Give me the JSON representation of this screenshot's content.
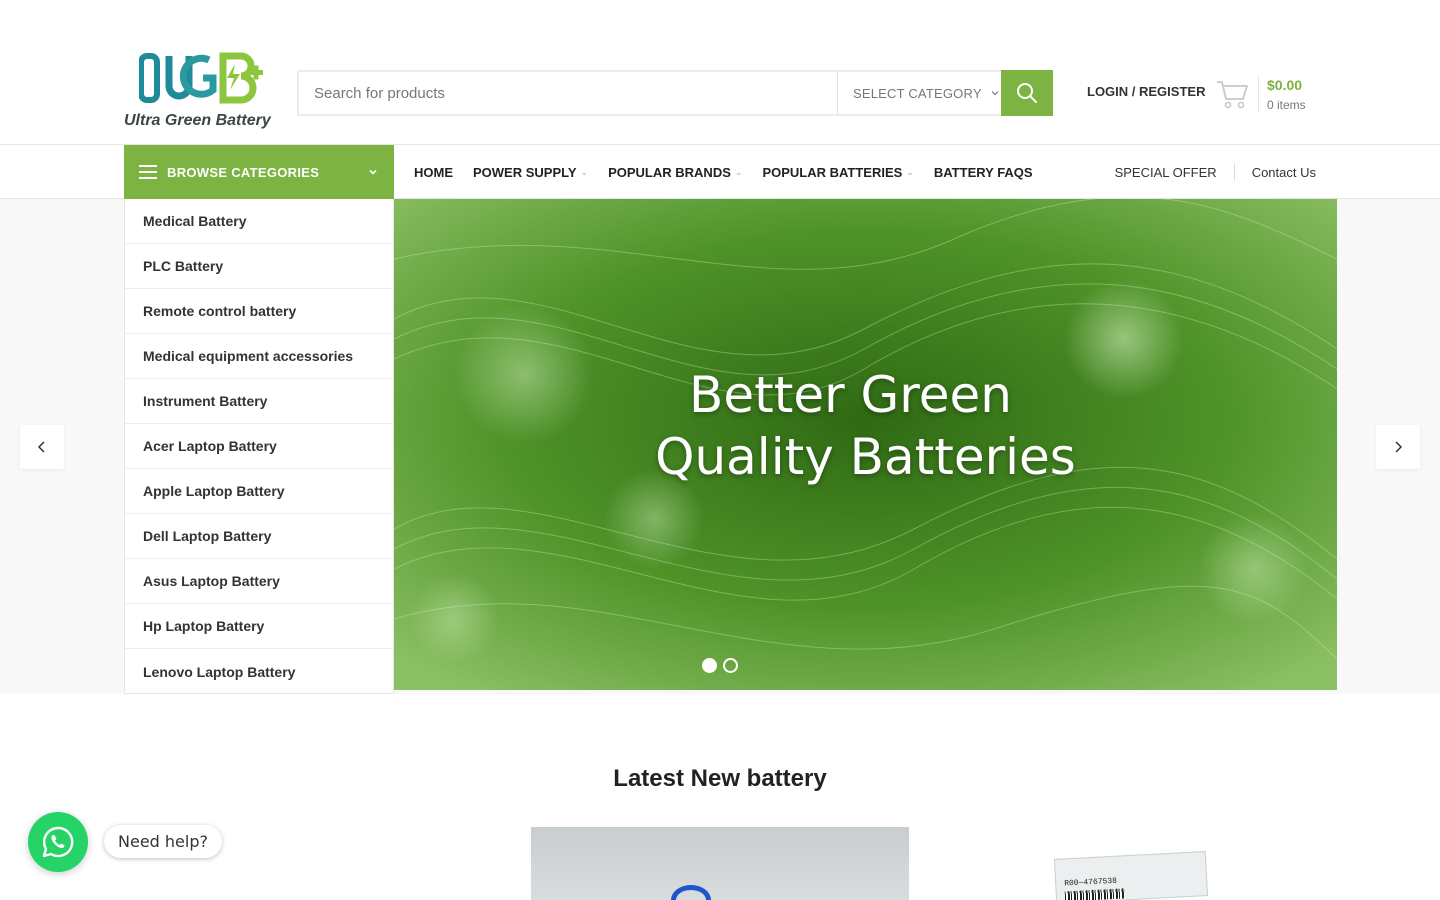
{
  "brand": {
    "logo_letters": "UGB",
    "name": "Ultra Green Battery",
    "colors": {
      "primary_green": "#7cb342",
      "logo_teal": "#1f8a9a",
      "logo_lime": "#8cc63f"
    }
  },
  "header": {
    "search_placeholder": "Search for products",
    "category_select": "SELECT CATEGORY",
    "search_icon": "search-icon",
    "login_label": "LOGIN / REGISTER",
    "cart": {
      "total": "$0.00",
      "items": "0 items",
      "icon": "cart-icon"
    }
  },
  "nav": {
    "browse_label": "BROWSE CATEGORIES",
    "menu": [
      {
        "label": "HOME",
        "dropdown": false
      },
      {
        "label": "POWER SUPPLY",
        "dropdown": true
      },
      {
        "label": "POPULAR BRANDS",
        "dropdown": true
      },
      {
        "label": "POPULAR BATTERIES",
        "dropdown": true
      },
      {
        "label": "BATTERY FAQS",
        "dropdown": false
      }
    ],
    "right_links": [
      "SPECIAL OFFER",
      "Contact Us"
    ]
  },
  "categories": [
    "Medical Battery",
    "PLC Battery",
    "Remote control battery",
    "Medical equipment accessories",
    "Instrument Battery",
    "Acer Laptop Battery",
    "Apple Laptop Battery",
    "Dell Laptop Battery",
    "Asus Laptop Battery",
    "Hp Laptop Battery",
    "Lenovo Laptop Battery"
  ],
  "slider": {
    "title_line1": "Better Green",
    "title_line2": "Quality Batteries",
    "slide_count": 2,
    "active_slide": 1
  },
  "latest": {
    "title": "Latest New battery",
    "product2_label": "R00—4767538"
  },
  "help_widget": {
    "label": "Need help?",
    "icon": "whatsapp-icon"
  }
}
